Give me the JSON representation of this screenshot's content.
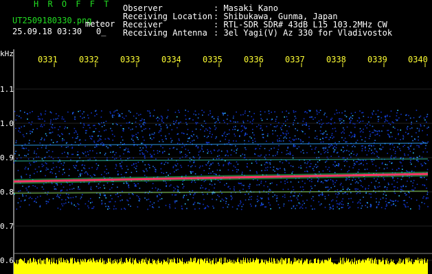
{
  "header": {
    "brand": "H R O F F T",
    "filename": "UT2509180330.png",
    "tag": "meteor",
    "datetime": "25.09.18 03:30",
    "flag": "0_",
    "fields": [
      {
        "label": "Observer",
        "value": ": Masaki Kano"
      },
      {
        "label": "Receiving Location",
        "value": ": Shibukawa, Gunma, Japan"
      },
      {
        "label": "Receiver",
        "value": ": RTL-SDR SDR# 43dB L15 103.2MHz CW"
      },
      {
        "label": "Receiving Antenna",
        "value": ": 3el Yagi(V) Az 330 for Vladivostok"
      }
    ]
  },
  "axis": {
    "unit": "kHz",
    "y_ticks": [
      "1.1",
      "1.0",
      "0.9",
      "0.8",
      "0.7",
      "0.6"
    ],
    "x_ticks": [
      "0331",
      "0332",
      "0333",
      "0334",
      "0335",
      "0336",
      "0337",
      "0338",
      "0339",
      "0340"
    ]
  },
  "colors": {
    "background": "#000000",
    "signal_low": "#1133cc",
    "signal_mid": "#33ccff",
    "signal_peak": "#ff3366",
    "noise_bar": "#ffff00",
    "label": "#ffffff",
    "tick": "#ffff33"
  }
}
